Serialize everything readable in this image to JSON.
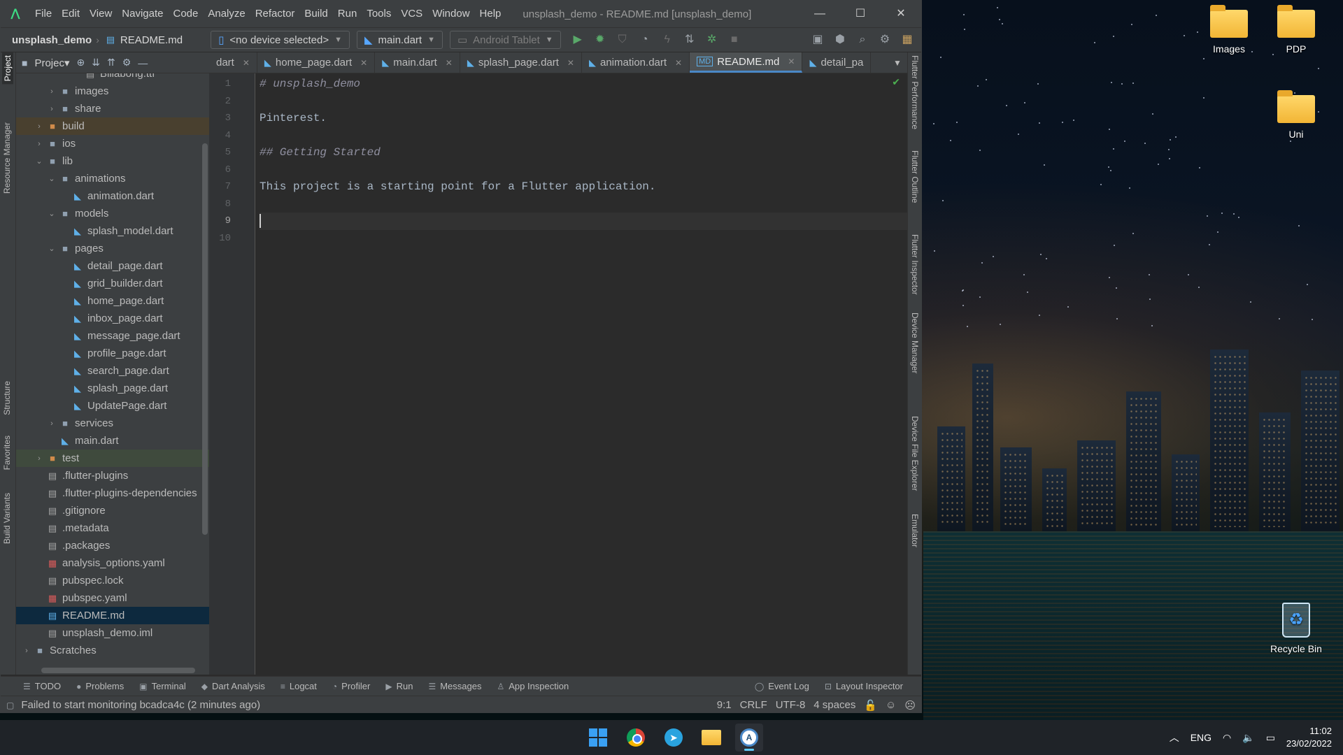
{
  "ide": {
    "title": "unsplash_demo - README.md [unsplash_demo]",
    "menu": [
      "File",
      "Edit",
      "View",
      "Navigate",
      "Code",
      "Analyze",
      "Refactor",
      "Build",
      "Run",
      "Tools",
      "VCS",
      "Window",
      "Help"
    ],
    "breadcrumb": {
      "project": "unsplash_demo",
      "file": "README.md"
    },
    "device_select": "<no device selected>",
    "run_config": "main.dart",
    "virtual_device": "Android Tablet"
  },
  "left_tool_tabs": [
    "Project",
    "Resource Manager",
    "Structure",
    "Favorites",
    "Build Variants"
  ],
  "right_tool_tabs": [
    "Flutter Performance",
    "Flutter Outline",
    "Flutter Inspector",
    "Device Manager",
    "Device File Explorer",
    "Emulator"
  ],
  "project_panel": {
    "header": "Projec▾",
    "tree": [
      {
        "label": "Billabong.ttf",
        "indent": 4,
        "icon": "file",
        "arrow": ""
      },
      {
        "label": "images",
        "indent": 2,
        "icon": "folder",
        "arrow": ">"
      },
      {
        "label": "share",
        "indent": 2,
        "icon": "folder",
        "arrow": ">"
      },
      {
        "label": "build",
        "indent": 1,
        "icon": "folder-orange",
        "arrow": ">"
      },
      {
        "label": "ios",
        "indent": 1,
        "icon": "folder",
        "arrow": ">"
      },
      {
        "label": "lib",
        "indent": 1,
        "icon": "folder",
        "arrow": "v"
      },
      {
        "label": "animations",
        "indent": 2,
        "icon": "folder",
        "arrow": "v"
      },
      {
        "label": "animation.dart",
        "indent": 3,
        "icon": "dart",
        "arrow": ""
      },
      {
        "label": "models",
        "indent": 2,
        "icon": "folder",
        "arrow": "v"
      },
      {
        "label": "splash_model.dart",
        "indent": 3,
        "icon": "dart",
        "arrow": ""
      },
      {
        "label": "pages",
        "indent": 2,
        "icon": "folder",
        "arrow": "v"
      },
      {
        "label": "detail_page.dart",
        "indent": 3,
        "icon": "dart",
        "arrow": ""
      },
      {
        "label": "grid_builder.dart",
        "indent": 3,
        "icon": "dart",
        "arrow": ""
      },
      {
        "label": "home_page.dart",
        "indent": 3,
        "icon": "dart",
        "arrow": ""
      },
      {
        "label": "inbox_page.dart",
        "indent": 3,
        "icon": "dart",
        "arrow": ""
      },
      {
        "label": "message_page.dart",
        "indent": 3,
        "icon": "dart",
        "arrow": ""
      },
      {
        "label": "profile_page.dart",
        "indent": 3,
        "icon": "dart",
        "arrow": ""
      },
      {
        "label": "search_page.dart",
        "indent": 3,
        "icon": "dart",
        "arrow": ""
      },
      {
        "label": "splash_page.dart",
        "indent": 3,
        "icon": "dart",
        "arrow": ""
      },
      {
        "label": "UpdatePage.dart",
        "indent": 3,
        "icon": "dart",
        "arrow": ""
      },
      {
        "label": "services",
        "indent": 2,
        "icon": "folder",
        "arrow": ">"
      },
      {
        "label": "main.dart",
        "indent": 2,
        "icon": "dart",
        "arrow": ""
      },
      {
        "label": "test",
        "indent": 1,
        "icon": "folder-orange",
        "arrow": ">"
      },
      {
        "label": ".flutter-plugins",
        "indent": 1,
        "icon": "file",
        "arrow": ""
      },
      {
        "label": ".flutter-plugins-dependencies",
        "indent": 1,
        "icon": "file",
        "arrow": ""
      },
      {
        "label": ".gitignore",
        "indent": 1,
        "icon": "file",
        "arrow": ""
      },
      {
        "label": ".metadata",
        "indent": 1,
        "icon": "file",
        "arrow": ""
      },
      {
        "label": ".packages",
        "indent": 1,
        "icon": "file",
        "arrow": ""
      },
      {
        "label": "analysis_options.yaml",
        "indent": 1,
        "icon": "yaml",
        "arrow": ""
      },
      {
        "label": "pubspec.lock",
        "indent": 1,
        "icon": "file",
        "arrow": ""
      },
      {
        "label": "pubspec.yaml",
        "indent": 1,
        "icon": "yaml",
        "arrow": ""
      },
      {
        "label": "README.md",
        "indent": 1,
        "icon": "md",
        "arrow": ""
      },
      {
        "label": "unsplash_demo.iml",
        "indent": 1,
        "icon": "file",
        "arrow": ""
      },
      {
        "label": "Scratches",
        "indent": 0,
        "icon": "folder",
        "arrow": ">"
      }
    ]
  },
  "editor_tabs": [
    {
      "label": "dart",
      "icon": "",
      "active": false
    },
    {
      "label": "home_page.dart",
      "icon": "dart",
      "active": false
    },
    {
      "label": "main.dart",
      "icon": "dart",
      "active": false
    },
    {
      "label": "splash_page.dart",
      "icon": "dart",
      "active": false
    },
    {
      "label": "animation.dart",
      "icon": "dart",
      "active": false
    },
    {
      "label": "README.md",
      "icon": "md",
      "active": true
    },
    {
      "label": "detail_pa",
      "icon": "dart",
      "active": false
    }
  ],
  "editor": {
    "lines": [
      "# unsplash_demo",
      "",
      "Pinterest.",
      "",
      "## Getting Started",
      "",
      "This project is a starting point for a Flutter application.",
      "",
      "",
      ""
    ],
    "current_line": 9
  },
  "bottom_tools": {
    "left": [
      "TODO",
      "Problems",
      "Terminal",
      "Dart Analysis",
      "Logcat",
      "Profiler",
      "Run",
      "Messages",
      "App Inspection"
    ],
    "right": [
      "Event Log",
      "Layout Inspector"
    ]
  },
  "status_bar": {
    "message": "Failed to start monitoring bcadca4c (2 minutes ago)",
    "position": "9:1",
    "line_sep": "CRLF",
    "encoding": "UTF-8",
    "indent": "4 spaces"
  },
  "desktop_icons": [
    "Images",
    "PDP",
    "Uni",
    "Recycle Bin"
  ],
  "taskbar": {
    "lang": "ENG",
    "time": "11:02",
    "date": "23/02/2022"
  },
  "colors": {
    "accent": "#4a88c7",
    "ide_bg": "#2b2b2b",
    "panel_bg": "#3c3f41",
    "selected_file": "#0d293e"
  }
}
